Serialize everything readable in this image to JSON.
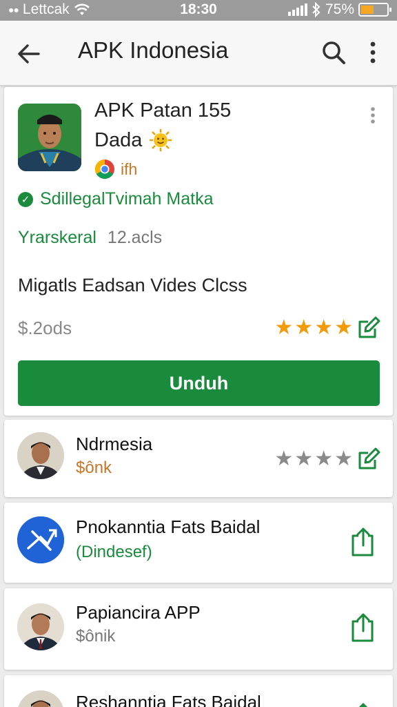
{
  "status_bar": {
    "carrier": "Lettcak",
    "time": "18:30",
    "battery": "75%",
    "battery_level": 0.4
  },
  "app_bar": {
    "title": "APK Indonesia",
    "icons": [
      "arrow-back-icon",
      "search-icon",
      "more-vert-icon"
    ]
  },
  "main_app": {
    "title_line1": "APK Patan 155",
    "title_line2": "Dada",
    "title_emoji": "🌞",
    "developer": "ifh",
    "verified_text": "SdillegalTvimah Matka",
    "category": "Yrarskeral",
    "size": "12.acls",
    "description": "Migatls Eadsan Vides Clcss",
    "price": "$.2ods",
    "rating": 4,
    "download_label": "Unduh",
    "colors": {
      "accent": "#1a8a3c",
      "star": "#f29b0a",
      "developer": "#c2772a"
    }
  },
  "list": [
    {
      "name": "Ndrmesia",
      "sub": "$ônk",
      "sub_color": "#c2772a",
      "rating": 4,
      "action": "edit-icon"
    },
    {
      "name": "Pnokanntia Fats Baidal",
      "sub": "(Dindesef)",
      "sub_color": "#1a8a3c",
      "action": "share-icon"
    },
    {
      "name": "Papiancira APP",
      "sub": "$ônik",
      "sub_color": "#777777",
      "action": "share-icon"
    },
    {
      "name": "Reshanntia Fats Baidal",
      "action": "share-icon"
    }
  ]
}
